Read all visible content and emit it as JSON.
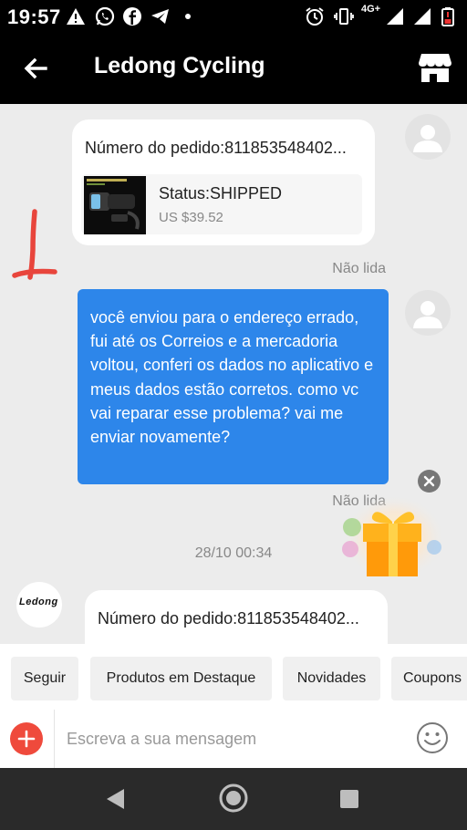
{
  "status_bar": {
    "time": "19:57",
    "network": "4G+",
    "left_icons": [
      "alert-icon",
      "whatsapp-icon",
      "facebook-icon",
      "telegram-icon",
      "dot-icon"
    ],
    "right_icons": [
      "alarm-icon",
      "vibrate-icon",
      "signal-icon",
      "signal-icon",
      "battery-low-icon"
    ]
  },
  "header": {
    "title": "Ledong Cycling"
  },
  "chat": {
    "order_card_1": {
      "order_number": "Número do pedido:811853548402...",
      "status": "Status:SHIPPED",
      "price": "US $39.52"
    },
    "unread_1": "Não lida",
    "customer_message": "você enviou para o endereço errado, fui até os Correios e a mercadoria voltou, conferi os dados no aplicativo e meus dados estão corretos. como vc vai reparar esse problema? vai me enviar novamente?",
    "unread_2": "Não lida",
    "timestamp": "28/10 00:34",
    "shop_logo": "Ledong",
    "order_card_2": {
      "order_number": "Número do pedido:811853548402..."
    }
  },
  "quick_replies": [
    "Seguir",
    "Produtos em Destaque",
    "Novidades",
    "Coupons"
  ],
  "input_bar": {
    "placeholder": "Escreva a sua mensagem"
  },
  "colors": {
    "bubble": "#2d86ea",
    "plus_button": "#ef4a3c",
    "header": "#000000",
    "chat_background": "#ececec"
  }
}
